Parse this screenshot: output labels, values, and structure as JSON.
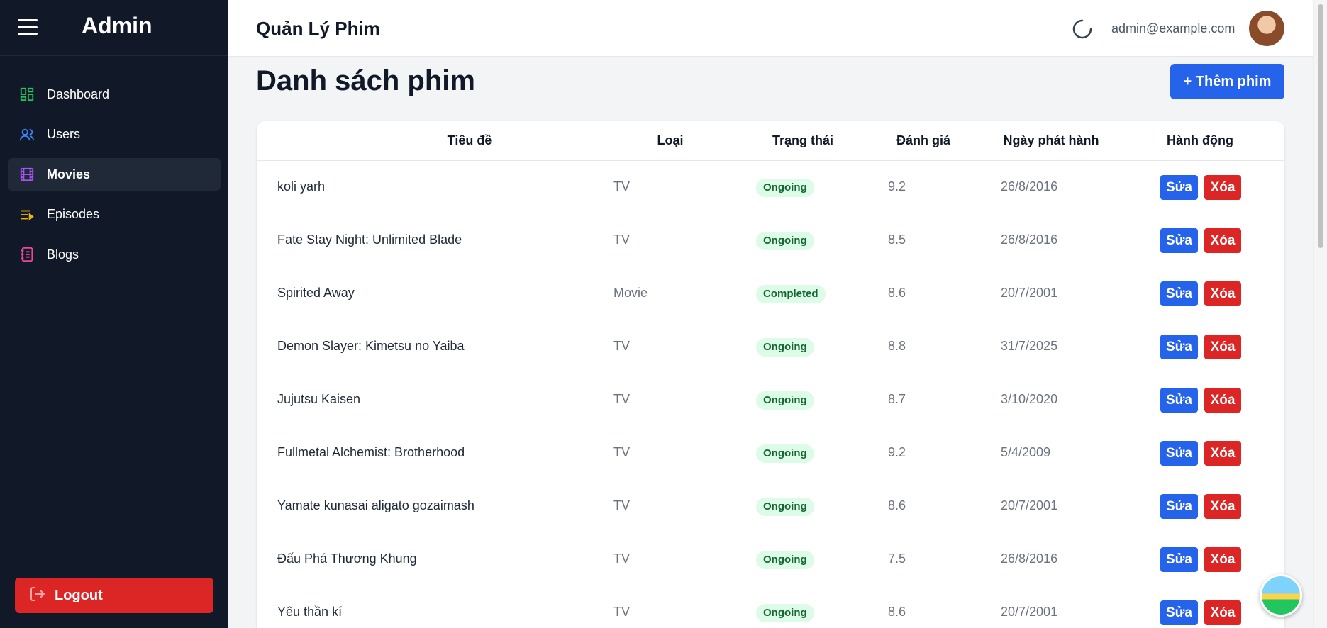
{
  "sidebar": {
    "title": "Admin",
    "items": [
      {
        "label": "Dashboard",
        "icon": "dashboard-icon",
        "color": "#22c55e"
      },
      {
        "label": "Users",
        "icon": "users-icon",
        "color": "#3b82f6"
      },
      {
        "label": "Movies",
        "icon": "film-icon",
        "color": "#a855f7",
        "active": true
      },
      {
        "label": "Episodes",
        "icon": "playlist-icon",
        "color": "#eab308"
      },
      {
        "label": "Blogs",
        "icon": "notebook-icon",
        "color": "#ec4899"
      }
    ],
    "logout_label": "Logout"
  },
  "header": {
    "title": "Quản Lý Phim",
    "email": "admin@example.com"
  },
  "page": {
    "heading": "Danh sách phim",
    "add_button": "+ Thêm phim"
  },
  "table": {
    "columns": [
      "Tiêu đề",
      "Loại",
      "Trạng thái",
      "Đánh giá",
      "Ngày phát hành",
      "Hành động"
    ],
    "edit_label": "Sửa",
    "delete_label": "Xóa",
    "rows": [
      {
        "title": "koli yarh",
        "type": "TV",
        "status": "Ongoing",
        "rating": "9.2",
        "date": "26/8/2016"
      },
      {
        "title": "Fate Stay Night: Unlimited Blade",
        "type": "TV",
        "status": "Ongoing",
        "rating": "8.5",
        "date": "26/8/2016"
      },
      {
        "title": "Spirited Away",
        "type": "Movie",
        "status": "Completed",
        "rating": "8.6",
        "date": "20/7/2001"
      },
      {
        "title": "Demon Slayer: Kimetsu no Yaiba",
        "type": "TV",
        "status": "Ongoing",
        "rating": "8.8",
        "date": "31/7/2025"
      },
      {
        "title": "Jujutsu Kaisen",
        "type": "TV",
        "status": "Ongoing",
        "rating": "8.7",
        "date": "3/10/2020"
      },
      {
        "title": "Fullmetal Alchemist: Brotherhood",
        "type": "TV",
        "status": "Ongoing",
        "rating": "9.2",
        "date": "5/4/2009"
      },
      {
        "title": "Yamate kunasai aligato gozaimash",
        "type": "TV",
        "status": "Ongoing",
        "rating": "8.6",
        "date": "20/7/2001"
      },
      {
        "title": "Đấu Phá Thương Khung",
        "type": "TV",
        "status": "Ongoing",
        "rating": "7.5",
        "date": "26/8/2016"
      },
      {
        "title": "Yêu thần kí",
        "type": "TV",
        "status": "Ongoing",
        "rating": "8.6",
        "date": "20/7/2001"
      }
    ]
  },
  "colors": {
    "sidebar_bg": "#111827",
    "primary": "#2563eb",
    "danger": "#dc2626",
    "badge_bg": "#dcfce7",
    "badge_text": "#166534"
  }
}
